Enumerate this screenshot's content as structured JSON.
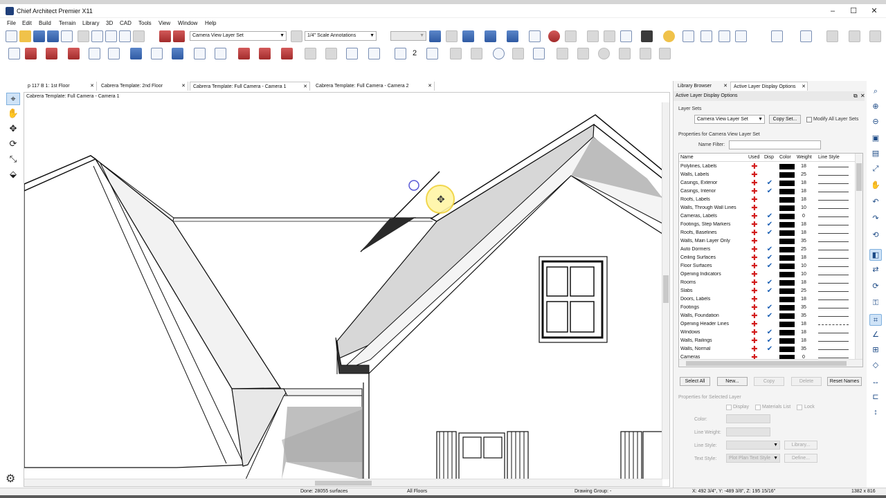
{
  "window": {
    "title": "Chief Architect Premier X11",
    "minimize": "–",
    "maximize": "☐",
    "close": "✕"
  },
  "menu": [
    "File",
    "Edit",
    "Build",
    "Terrain",
    "Library",
    "3D",
    "CAD",
    "Tools",
    "View",
    "Window",
    "Help"
  ],
  "toolbar": {
    "layer_set": "Camera View Layer Set",
    "annotation_set": "1/4\" Scale Annotations",
    "counter": "2"
  },
  "tabs": [
    {
      "label": "p 117 B 1: 1st Floor",
      "active": false
    },
    {
      "label": "Cabrera Template: 2nd Floor",
      "active": false
    },
    {
      "label": "Cabrera Template: Full Camera - Camera 1",
      "active": true
    },
    {
      "label": "Cabrera Template: Full Camera - Camera 2",
      "active": false
    }
  ],
  "viewport": {
    "title": "Cabrera Template: Full Camera - Camera 1"
  },
  "panel": {
    "tabs": [
      {
        "label": "Library Browser",
        "active": false
      },
      {
        "label": "Active Layer Display Options",
        "active": true
      }
    ],
    "header": "Active Layer Display Options",
    "layer_sets_label": "Layer Sets",
    "layer_set_value": "Camera View Layer Set",
    "copy_set_button": "Copy Set...",
    "modify_all_label": "Modify All Layer Sets",
    "properties_label": "Properties for Camera View Layer Set",
    "name_filter_label": "Name Filter:",
    "name_filter_value": "",
    "columns": {
      "name": "Name",
      "used": "Used",
      "disp": "Disp",
      "color": "Color",
      "weight": "Weight",
      "line_style": "Line Style"
    },
    "layers": [
      {
        "name": "Polylines, Labels",
        "disp": false,
        "weight": "18",
        "line": "solid"
      },
      {
        "name": "Walls, Labels",
        "disp": false,
        "weight": "25",
        "line": "solid"
      },
      {
        "name": "Casings, Exterior",
        "disp": true,
        "weight": "18",
        "line": "solid"
      },
      {
        "name": "Casings, Interior",
        "disp": true,
        "weight": "18",
        "line": "solid"
      },
      {
        "name": "Roofs, Labels",
        "disp": false,
        "weight": "18",
        "line": "solid"
      },
      {
        "name": "Walls, Through Wall Lines",
        "disp": false,
        "weight": "10",
        "line": "solid"
      },
      {
        "name": "Cameras, Labels",
        "disp": true,
        "weight": "0",
        "line": "solid"
      },
      {
        "name": "Footings, Step Markers",
        "disp": true,
        "weight": "18",
        "line": "solid"
      },
      {
        "name": "Roofs, Baselines",
        "disp": true,
        "weight": "18",
        "line": "solid"
      },
      {
        "name": "Walls, Main Layer Only",
        "disp": false,
        "weight": "35",
        "line": "solid"
      },
      {
        "name": "Auto Dormers",
        "disp": true,
        "weight": "25",
        "line": "solid"
      },
      {
        "name": "Ceiling Surfaces",
        "disp": true,
        "weight": "18",
        "line": "solid"
      },
      {
        "name": "Floor Surfaces",
        "disp": true,
        "weight": "10",
        "line": "solid"
      },
      {
        "name": "Opening Indicators",
        "disp": false,
        "weight": "10",
        "line": "solid"
      },
      {
        "name": "Rooms",
        "disp": true,
        "weight": "18",
        "line": "solid"
      },
      {
        "name": "Slabs",
        "disp": true,
        "weight": "25",
        "line": "solid"
      },
      {
        "name": "Doors, Labels",
        "disp": false,
        "weight": "18",
        "line": "solid"
      },
      {
        "name": "Footings",
        "disp": true,
        "weight": "35",
        "line": "solid"
      },
      {
        "name": "Walls,  Foundation",
        "disp": true,
        "weight": "35",
        "line": "solid"
      },
      {
        "name": "Opening Header Lines",
        "disp": false,
        "weight": "18",
        "line": "dashed"
      },
      {
        "name": "Windows",
        "disp": true,
        "weight": "18",
        "line": "solid"
      },
      {
        "name": "Walls,  Railings",
        "disp": true,
        "weight": "18",
        "line": "solid"
      },
      {
        "name": "Walls,  Normal",
        "disp": true,
        "weight": "35",
        "line": "solid"
      },
      {
        "name": "Cameras",
        "disp": false,
        "weight": "0",
        "line": "solid"
      }
    ],
    "buttons": {
      "select_all": "Select All",
      "new": "New...",
      "copy": "Copy",
      "delete": "Delete",
      "reset_names": "Reset Names"
    },
    "selected_props_label": "Properties for Selected Layer",
    "display_label": "Display",
    "materials_list_label": "Materials List",
    "lock_label": "Lock",
    "color_label": "Color:",
    "line_weight_label": "Line Weight:",
    "line_style_label": "Line Style:",
    "library_button": "Library...",
    "text_style_label": "Text Style:",
    "text_style_value": "Plot Plan Text Style",
    "define_button": "Define..."
  },
  "status": {
    "done": "Done:  28055 surfaces",
    "floors": "All Floors",
    "drawing_group": "Drawing Group:  -",
    "coords": "X: 492 3/4\", Y: -489 3/8\", Z: 195 15/16\"",
    "size": "1382 x 816"
  }
}
